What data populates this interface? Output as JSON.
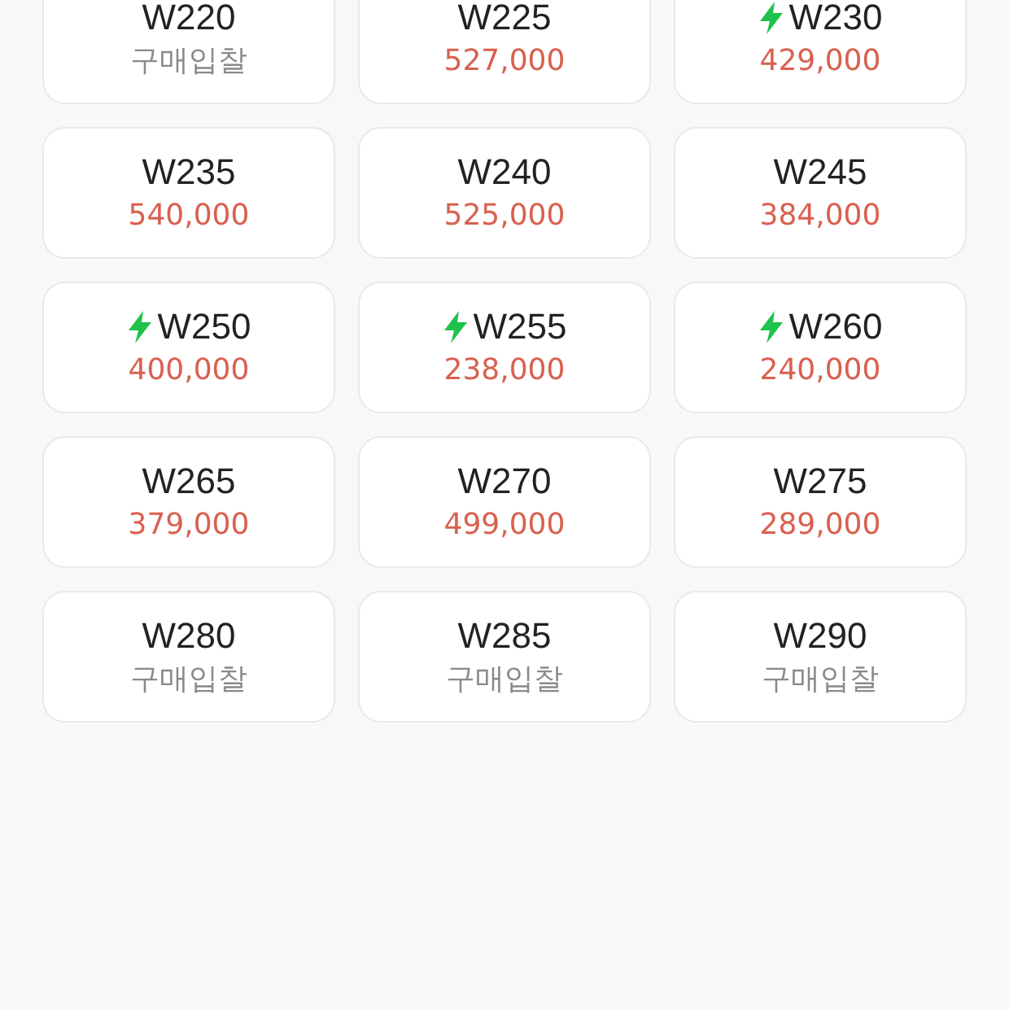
{
  "sizes": [
    {
      "size": "W220",
      "fast": false,
      "kind": "bid",
      "price": "구매입찰"
    },
    {
      "size": "W225",
      "fast": false,
      "kind": "price",
      "price": "527,000"
    },
    {
      "size": "W230",
      "fast": true,
      "kind": "price",
      "price": "429,000"
    },
    {
      "size": "W235",
      "fast": false,
      "kind": "price",
      "price": "540,000"
    },
    {
      "size": "W240",
      "fast": false,
      "kind": "price",
      "price": "525,000"
    },
    {
      "size": "W245",
      "fast": false,
      "kind": "price",
      "price": "384,000"
    },
    {
      "size": "W250",
      "fast": true,
      "kind": "price",
      "price": "400,000"
    },
    {
      "size": "W255",
      "fast": true,
      "kind": "price",
      "price": "238,000"
    },
    {
      "size": "W260",
      "fast": true,
      "kind": "price",
      "price": "240,000"
    },
    {
      "size": "W265",
      "fast": false,
      "kind": "price",
      "price": "379,000"
    },
    {
      "size": "W270",
      "fast": false,
      "kind": "price",
      "price": "499,000"
    },
    {
      "size": "W275",
      "fast": false,
      "kind": "price",
      "price": "289,000"
    },
    {
      "size": "W280",
      "fast": false,
      "kind": "bid",
      "price": "구매입찰"
    },
    {
      "size": "W285",
      "fast": false,
      "kind": "bid",
      "price": "구매입찰"
    },
    {
      "size": "W290",
      "fast": false,
      "kind": "bid",
      "price": "구매입찰"
    }
  ]
}
